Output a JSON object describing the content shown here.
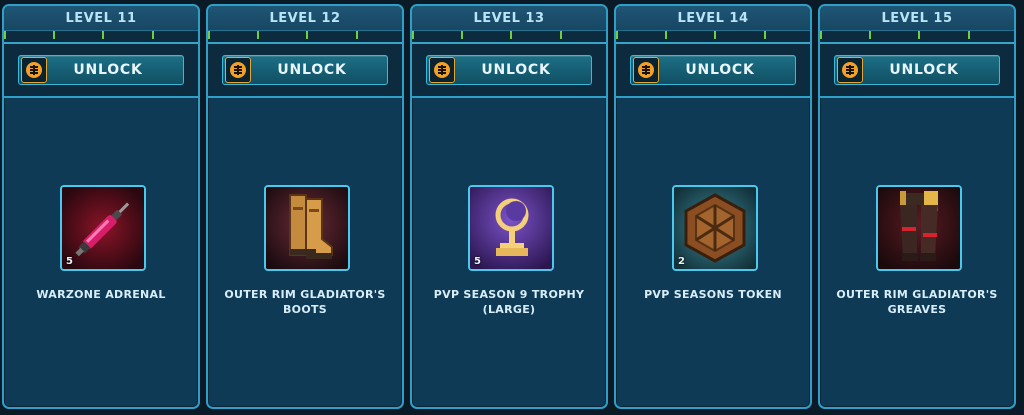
{
  "levels": [
    {
      "level_label": "LEVEL 11",
      "unlock_label": "UNLOCK",
      "reward_name": "WARZONE ADRENAL",
      "quantity": "5",
      "icon": "adrenal-syringe-icon"
    },
    {
      "level_label": "LEVEL 12",
      "unlock_label": "UNLOCK",
      "reward_name": "OUTER RIM GLADIATOR'S BOOTS",
      "quantity": "",
      "icon": "boots-icon"
    },
    {
      "level_label": "LEVEL 13",
      "unlock_label": "UNLOCK",
      "reward_name": "PVP SEASON 9 TROPHY (LARGE)",
      "quantity": "5",
      "icon": "trophy-icon"
    },
    {
      "level_label": "LEVEL 14",
      "unlock_label": "UNLOCK",
      "reward_name": "PVP SEASONS TOKEN",
      "quantity": "2",
      "icon": "token-icon"
    },
    {
      "level_label": "LEVEL 15",
      "unlock_label": "UNLOCK",
      "reward_name": "OUTER RIM GLADIATOR'S GREAVES",
      "quantity": "",
      "icon": "greaves-icon"
    }
  ],
  "colors": {
    "panel": "#0f3a55",
    "border": "#2f9fc8",
    "progress_tick": "#6fcf3c",
    "coin": "#f2a125"
  }
}
